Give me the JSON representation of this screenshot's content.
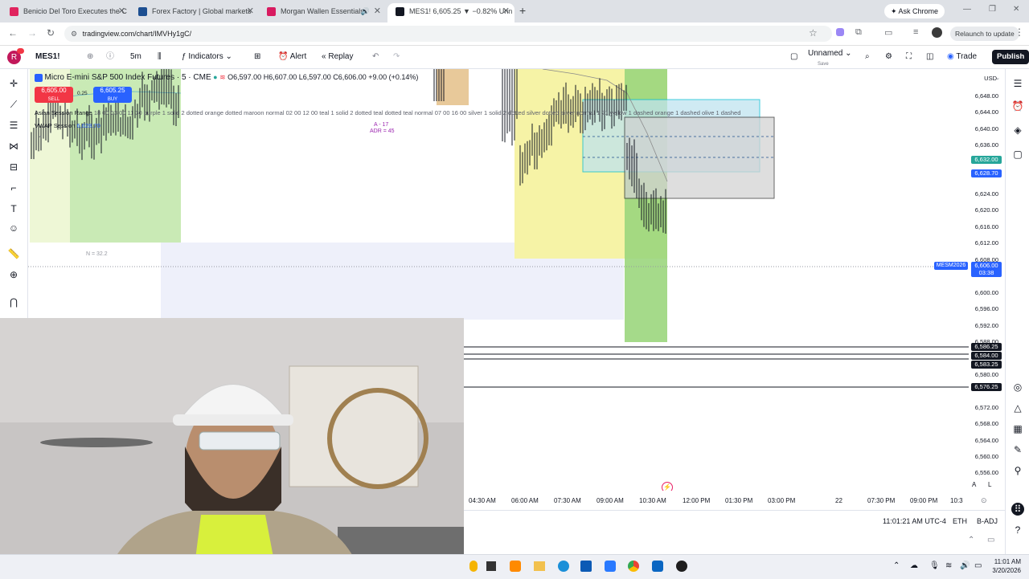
{
  "browser": {
    "tabs": [
      {
        "title": "Benicio Del Toro Executes the C",
        "color": "#e0245e"
      },
      {
        "title": "Forex Factory | Global markets",
        "color": "#1d4f91"
      },
      {
        "title": "Morgan Wallen Essentials",
        "color": "#d81b60"
      },
      {
        "title": "MES1! 6,605.25 ▼ −0.82% Unn",
        "color": "#131722"
      }
    ],
    "ask_chrome": "Ask Chrome",
    "url": "tradingview.com/chart/IMVHy1gC/",
    "relaunch": "Relaunch to update",
    "avatar_letter": "R"
  },
  "toolbar": {
    "symbol": "MES1!",
    "interval": "5m",
    "indicators": "Indicators",
    "alert": "Alert",
    "replay": "Replay",
    "layout_name": "Unnamed",
    "layout_sub": "Save",
    "trade": "Trade",
    "publish": "Publish"
  },
  "legend": {
    "title": "Micro E-mini S&P 500 Index Futures · 5 · CME",
    "ohlc": "O6,597.00 H6,607.00 L6,597.00 C6,606.00 +9.00 (+0.14%)",
    "sell_price": "6,605.00",
    "sell_label": "SELL",
    "spread": "0.25",
    "buy_price": "6,605.25",
    "buy_label": "BUY",
    "asian_label": "Asian Session Range",
    "asian_params": "18 00 03 00 11 30 purple 1 solid 2 dotted orange dotted maroon normal 02 00 12 00 teal 1 solid 2 dotted teal dotted teal normal 07 00 16 00 silver 1 solid 2 dotted silver dotted silver normal 1 21 yellow 1 dashed orange 1 dashed olive 1 dashed",
    "vwap_label": "VWAP Session",
    "vwap_value": "6,628.70",
    "a_value": "A - 17",
    "adr_value": "ADR = 45",
    "n_value": "N = 32.2"
  },
  "price_scale": {
    "currency": "USD",
    "labels": [
      "6,648.00",
      "6,644.00",
      "6,640.00",
      "6,636.00",
      "6,624.00",
      "6,620.00",
      "6,616.00",
      "6,612.00",
      "6,608.00",
      "6,600.00",
      "6,596.00",
      "6,592.00",
      "6,588.00",
      "6,580.00",
      "6,572.00",
      "6,568.00",
      "6,564.00",
      "6,560.00",
      "6,556.00"
    ],
    "badge_green": "6,632.00",
    "badge_blue": "6,628.70",
    "symbol_tag": "MESM2026",
    "last_price": "6,606.00",
    "countdown": "03:38",
    "level1": "6,586.25",
    "level2": "6,584.00",
    "level3": "6,583.25",
    "level4": "6,576.25"
  },
  "time_scale": {
    "labels": [
      "04:30 AM",
      "06:00 AM",
      "07:30 AM",
      "09:00 AM",
      "10:30 AM",
      "12:00 PM",
      "01:30 PM",
      "03:00 PM",
      "22",
      "07:30 PM",
      "09:00 PM",
      "10:3"
    ]
  },
  "status": {
    "clock": "11:01:21 AM UTC-4",
    "session": "ETH",
    "adj": "B-ADJ",
    "scale_a": "A",
    "scale_l": "L"
  },
  "taskbar": {
    "time": "11:01 AM",
    "date": "3/20/2026"
  },
  "colors": {
    "sell": "#f23645",
    "buy": "#2962ff",
    "green_zone": "#9bd67d",
    "yellow_zone": "#f6f3a6",
    "publish_bg": "#131722"
  }
}
